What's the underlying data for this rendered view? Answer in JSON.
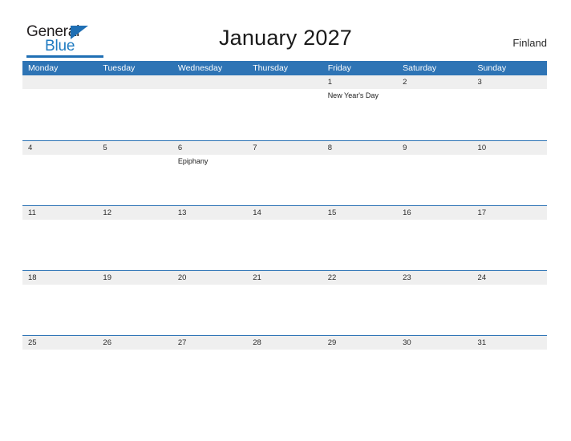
{
  "brand": {
    "name_part1": "General",
    "name_part2": "Blue",
    "flag_icon": "triangle-flag-icon",
    "accent_color": "#1f6fb4"
  },
  "header": {
    "title": "January 2027",
    "region": "Finland"
  },
  "theme": {
    "header_blue": "#2e74b5",
    "band_gray": "#efefef",
    "text_dark": "#1a1a1a",
    "white": "#ffffff"
  },
  "calendar": {
    "month": "January",
    "year": "2027",
    "weekday_headers": [
      "Monday",
      "Tuesday",
      "Wednesday",
      "Thursday",
      "Friday",
      "Saturday",
      "Sunday"
    ],
    "weeks": [
      {
        "days": [
          {
            "number": "",
            "events": []
          },
          {
            "number": "",
            "events": []
          },
          {
            "number": "",
            "events": []
          },
          {
            "number": "",
            "events": []
          },
          {
            "number": "1",
            "events": [
              "New Year's Day"
            ]
          },
          {
            "number": "2",
            "events": []
          },
          {
            "number": "3",
            "events": []
          }
        ]
      },
      {
        "days": [
          {
            "number": "4",
            "events": []
          },
          {
            "number": "5",
            "events": []
          },
          {
            "number": "6",
            "events": [
              "Epiphany"
            ]
          },
          {
            "number": "7",
            "events": []
          },
          {
            "number": "8",
            "events": []
          },
          {
            "number": "9",
            "events": []
          },
          {
            "number": "10",
            "events": []
          }
        ]
      },
      {
        "days": [
          {
            "number": "11",
            "events": []
          },
          {
            "number": "12",
            "events": []
          },
          {
            "number": "13",
            "events": []
          },
          {
            "number": "14",
            "events": []
          },
          {
            "number": "15",
            "events": []
          },
          {
            "number": "16",
            "events": []
          },
          {
            "number": "17",
            "events": []
          }
        ]
      },
      {
        "days": [
          {
            "number": "18",
            "events": []
          },
          {
            "number": "19",
            "events": []
          },
          {
            "number": "20",
            "events": []
          },
          {
            "number": "21",
            "events": []
          },
          {
            "number": "22",
            "events": []
          },
          {
            "number": "23",
            "events": []
          },
          {
            "number": "24",
            "events": []
          }
        ]
      },
      {
        "days": [
          {
            "number": "25",
            "events": []
          },
          {
            "number": "26",
            "events": []
          },
          {
            "number": "27",
            "events": []
          },
          {
            "number": "28",
            "events": []
          },
          {
            "number": "29",
            "events": []
          },
          {
            "number": "30",
            "events": []
          },
          {
            "number": "31",
            "events": []
          }
        ]
      }
    ]
  }
}
